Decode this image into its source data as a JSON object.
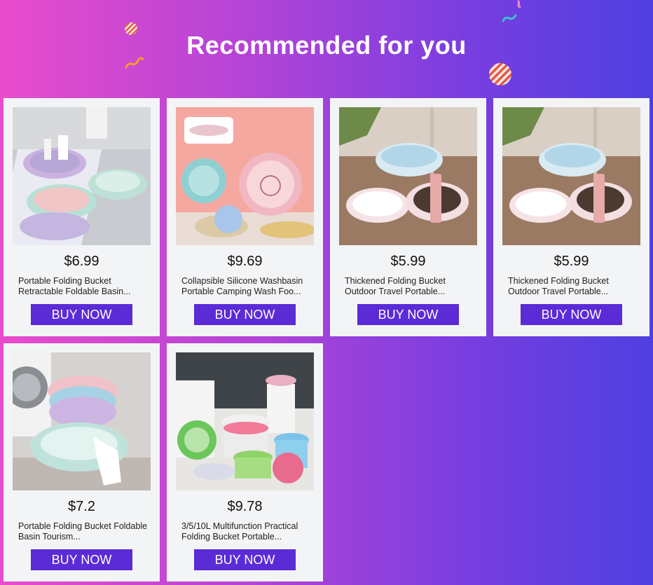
{
  "header": {
    "title": "Recommended for you"
  },
  "products": [
    {
      "price": "$6.99",
      "name": "Portable Folding Bucket Retractable Foldable Basin...",
      "cta": "BUY NOW",
      "image": "folding-basins-pastel"
    },
    {
      "price": "$9.69",
      "name": "Collapsible Silicone Washbasin Portable Camping Wash Foo...",
      "cta": "BUY NOW",
      "image": "silicone-washbasin-cartoon"
    },
    {
      "price": "$5.99",
      "name": "Thickened Folding Bucket Outdoor Travel Portable...",
      "cta": "BUY NOW",
      "image": "folding-bucket-mop"
    },
    {
      "price": "$5.99",
      "name": "Thickened Folding Bucket Outdoor Travel Portable...",
      "cta": "BUY NOW",
      "image": "folding-bucket-mop"
    },
    {
      "price": "$7.2",
      "name": "Portable Folding Bucket Foldable Basin Tourism...",
      "cta": "BUY NOW",
      "image": "folding-basins-washer"
    },
    {
      "price": "$9.78",
      "name": "3/5/10L Multifunction Practical Folding Bucket Portable...",
      "cta": "BUY NOW",
      "image": "multi-buckets"
    }
  ],
  "colors": {
    "button": "#5b2bd6",
    "card": "#f3f4f6",
    "gradient_start": "#e84ccc",
    "gradient_end": "#4f3fe0"
  }
}
